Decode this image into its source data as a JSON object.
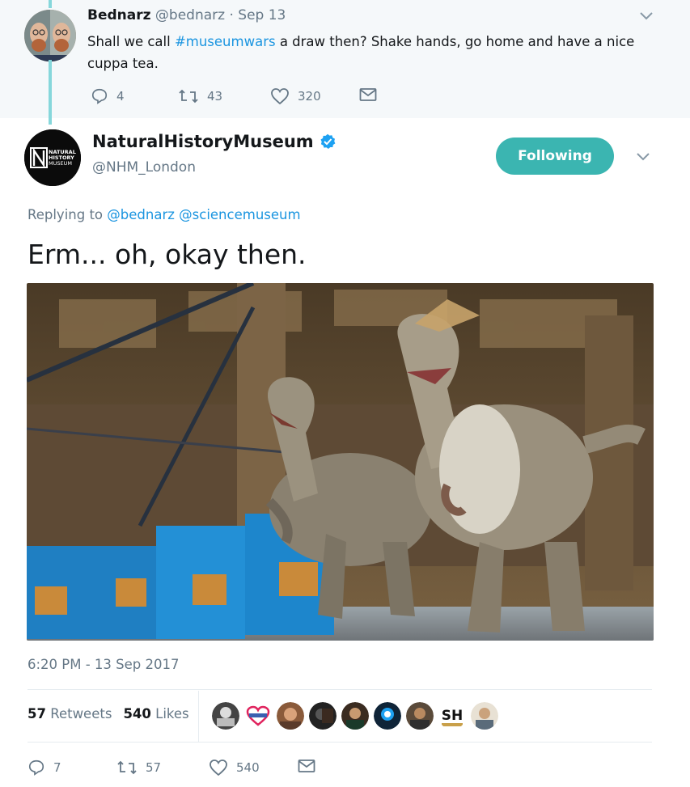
{
  "parent_tweet": {
    "name": "Bednarz",
    "handle": "@bednarz",
    "separator": "·",
    "date": "Sep 13",
    "text_before": "Shall we call ",
    "hashtag": "#museumwars",
    "text_after": " a draw then? Shake hands, go home and have a nice cuppa tea.",
    "replies": "4",
    "retweets": "43",
    "likes": "320"
  },
  "main_tweet": {
    "name": "NaturalHistoryMuseum",
    "handle": "@NHM_London",
    "avatar_logo_text": [
      "NATURAL",
      "HISTORY",
      "MUSEUM"
    ],
    "follow_label": "Following",
    "replying_prefix": "Replying to",
    "reply_mention_1": "@bednarz",
    "reply_mention_2": "@sciencemuseum",
    "text": "Erm... oh, okay then.",
    "photo_description_icon": "dinosaur-photo",
    "timestamp": "6:20 PM - 13 Sep 2017",
    "retweets_count": "57",
    "retweets_label": "Retweets",
    "likes_count": "540",
    "likes_label": "Likes",
    "liker_badge_text": "SH",
    "action_replies": "7",
    "action_retweets": "57",
    "action_likes": "540"
  },
  "colors": {
    "accent": "#3bb5b1",
    "link": "#1b95e0",
    "muted": "#657786",
    "thread_line": "#86d7db"
  },
  "icons": [
    "reply-icon",
    "retweet-icon",
    "heart-icon",
    "envelope-icon",
    "chevron-down-icon",
    "verified-badge-icon"
  ]
}
